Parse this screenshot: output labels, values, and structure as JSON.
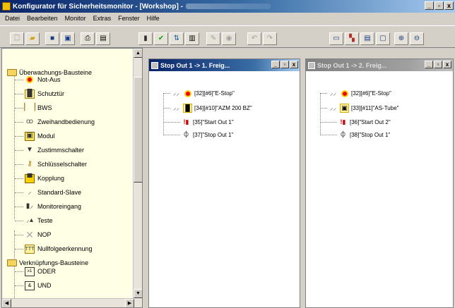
{
  "window": {
    "title": "Konfigurator für Sicherheitsmonitor - [Workshop] -",
    "minimize_label": "_",
    "maximize_label": "▫",
    "close_label": "x"
  },
  "menu": [
    "Datei",
    "Bearbeiten",
    "Monitor",
    "Extras",
    "Fenster",
    "Hilfe"
  ],
  "toolbar_icons": [
    "new-document-icon",
    "open-folder-icon",
    "save-icon",
    "save-all-icon",
    "print-icon",
    "print-preview-icon",
    "monitor-icon",
    "check-icon",
    "transfer-icon",
    "info-icon",
    "disabled-tool-icon",
    "disabled-eye-icon",
    "undo-icon",
    "redo-icon",
    "window-icon",
    "tile-icon",
    "cascade-icon",
    "maximize-window-icon",
    "zoom-in-icon",
    "zoom-out-icon"
  ],
  "tree": {
    "groups": [
      {
        "label": "Überwachungs-Bausteine",
        "items": [
          {
            "label": "Not-Aus",
            "icon": "emergency-stop-icon"
          },
          {
            "label": "Schutztür",
            "icon": "safety-door-icon"
          },
          {
            "label": "BWS",
            "icon": "light-curtain-icon"
          },
          {
            "label": "Zweihandbedienung",
            "icon": "two-hand-control-icon"
          },
          {
            "label": "Modul",
            "icon": "module-icon"
          },
          {
            "label": "Zustimmschalter",
            "icon": "enabling-switch-icon"
          },
          {
            "label": "Schlüsselschalter",
            "icon": "key-switch-icon"
          },
          {
            "label": "Kopplung",
            "icon": "coupling-icon"
          },
          {
            "label": "Standard-Slave",
            "icon": "standard-slave-icon"
          },
          {
            "label": "Monitoreingang",
            "icon": "monitor-input-icon"
          },
          {
            "label": "Teste",
            "icon": "test-icon"
          },
          {
            "label": "NOP",
            "icon": "nop-icon"
          },
          {
            "label": "Nullfolgeerkennung",
            "icon": "zero-sequence-icon"
          }
        ]
      },
      {
        "label": "Verknüpfungs-Bausteine",
        "items": [
          {
            "label": "ODER",
            "icon": "or-gate-icon"
          },
          {
            "label": "UND",
            "icon": "and-gate-icon"
          }
        ]
      }
    ]
  },
  "windows": [
    {
      "title": "Stop Out 1 -> 1. Freig...",
      "active": true,
      "nodes": [
        {
          "label": "[32][#6]\"E-Stop\"",
          "icon": "emergency-stop-icon"
        },
        {
          "label": "[34][#10]\"AZM 200 BZ\"",
          "icon": "safety-door-icon"
        },
        {
          "label": "[35]\"Start Out 1\"",
          "icon": "start-icon"
        },
        {
          "label": "[37]\"Stop Out 1\"",
          "icon": "stop-output-icon"
        }
      ]
    },
    {
      "title": "Stop Out 1 -> 2. Freig...",
      "active": false,
      "nodes": [
        {
          "label": "[32][#6]\"E-Stop\"",
          "icon": "emergency-stop-icon"
        },
        {
          "label": "[33][#11]\"AS-Tube\"",
          "icon": "module-icon"
        },
        {
          "label": "[36]\"Start Out 2\"",
          "icon": "start-icon"
        },
        {
          "label": "[38]\"Stop Out 1\"",
          "icon": "stop-output-icon"
        }
      ]
    }
  ]
}
